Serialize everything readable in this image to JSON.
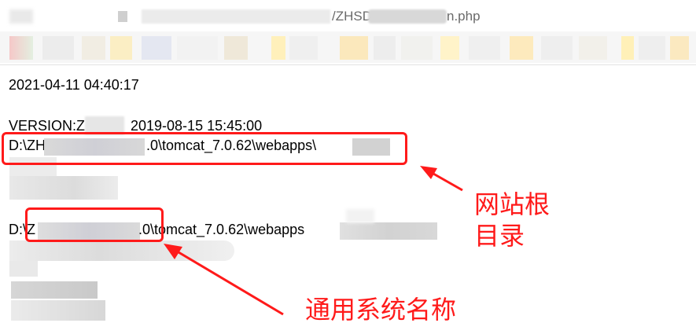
{
  "address_bar": {
    "url_visible_1": "/ZHSD",
    "url_visible_2": "n.php"
  },
  "content": {
    "date_line": "2021-04-11 04:40:17",
    "version_prefix": "VERSION:Z",
    "version_date": "2019-08-15 15:45:00",
    "path1_prefix": "D:\\ZH",
    "path1_suffix": ".0\\tomcat_7.0.62\\webapps\\",
    "path2_prefix": "D:\\Z",
    "path2_suffix": ".0\\tomcat_7.0.62\\webapps"
  },
  "annotations": {
    "label_web_root_line1": "网站根",
    "label_web_root_line2": "目录",
    "label_system_name": "通用系统名称",
    "color": "#ff1a1a"
  }
}
